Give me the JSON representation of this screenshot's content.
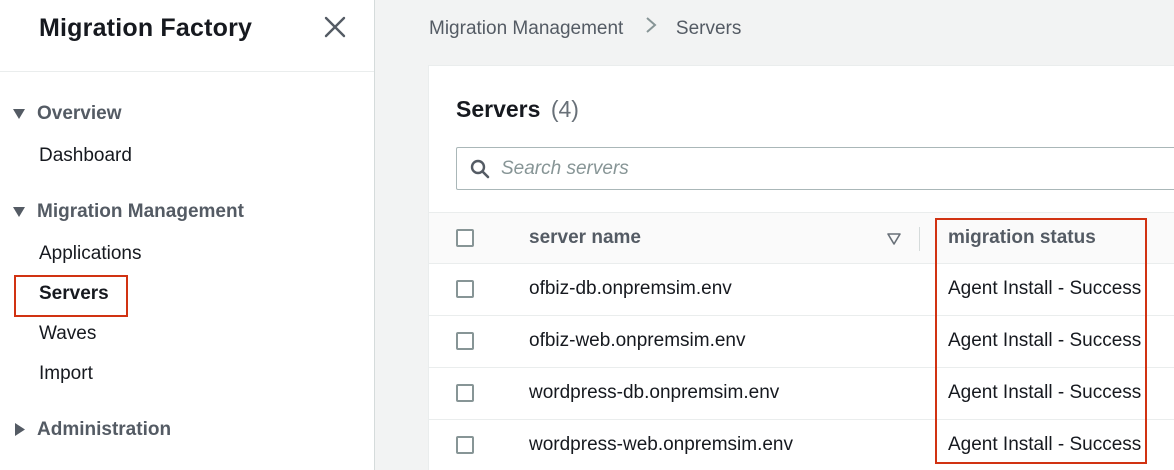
{
  "sidebar": {
    "title": "Migration Factory",
    "sections": [
      {
        "label": "Overview",
        "expanded": true,
        "items": [
          {
            "label": "Dashboard",
            "active": false
          }
        ]
      },
      {
        "label": "Migration Management",
        "expanded": true,
        "items": [
          {
            "label": "Applications",
            "active": false
          },
          {
            "label": "Servers",
            "active": true
          },
          {
            "label": "Waves",
            "active": false
          },
          {
            "label": "Import",
            "active": false
          }
        ]
      },
      {
        "label": "Administration",
        "expanded": false,
        "items": []
      }
    ]
  },
  "breadcrumb": [
    "Migration Management",
    "Servers"
  ],
  "panel": {
    "title": "Servers",
    "count": "(4)",
    "search_placeholder": "Search servers"
  },
  "table": {
    "columns": [
      "server name",
      "migration status"
    ],
    "rows": [
      {
        "server_name": "ofbiz-db.onpremsim.env",
        "migration_status": "Agent Install - Success"
      },
      {
        "server_name": "ofbiz-web.onpremsim.env",
        "migration_status": "Agent Install - Success"
      },
      {
        "server_name": "wordpress-db.onpremsim.env",
        "migration_status": "Agent Install - Success"
      },
      {
        "server_name": "wordpress-web.onpremsim.env",
        "migration_status": "Agent Install - Success"
      }
    ]
  },
  "colors": {
    "highlight": "#d13212",
    "text": "#16191f",
    "muted": "#545b64"
  },
  "icons": {
    "close": "close-icon",
    "search": "search-icon",
    "sort": "sort-desc-icon",
    "expanded": "caret-down-icon",
    "collapsed": "caret-right-icon",
    "separator": "chevron-right-icon"
  }
}
